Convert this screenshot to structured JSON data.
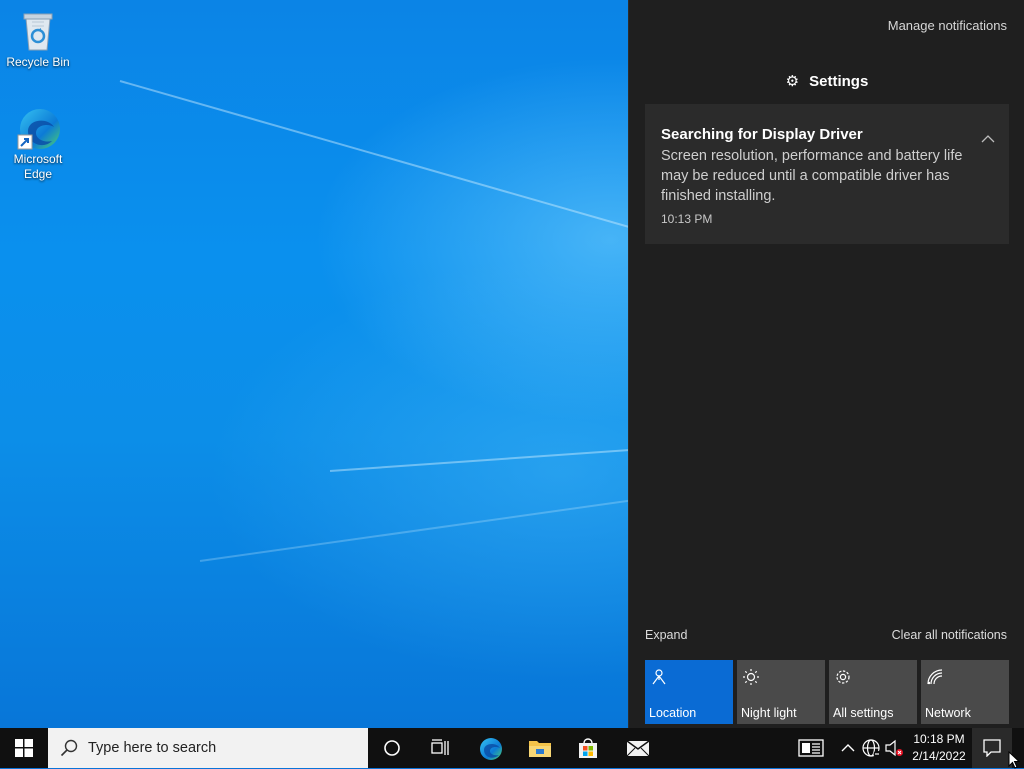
{
  "desktop": {
    "icons": [
      {
        "label": "Recycle Bin",
        "icon": "recycle-bin-icon"
      },
      {
        "label": "Microsoft Edge",
        "icon": "edge-icon"
      }
    ]
  },
  "action_center": {
    "manage_notifications": "Manage notifications",
    "group_header": "Settings",
    "group_icon": "gear-icon",
    "notification": {
      "title": "Searching for Display Driver",
      "body": "Screen resolution, performance and battery life may be reduced until a compatible driver has finished installing.",
      "time": "10:13 PM"
    },
    "expand": "Expand",
    "clear_all": "Clear all notifications",
    "quick_actions": [
      {
        "label": "Location",
        "icon": "location-icon",
        "active": true
      },
      {
        "label": "Night light",
        "icon": "night-light-icon",
        "active": false
      },
      {
        "label": "All settings",
        "icon": "gear-icon",
        "active": false
      },
      {
        "label": "Network",
        "icon": "network-icon",
        "active": false
      }
    ]
  },
  "taskbar": {
    "search_placeholder": "Type here to search",
    "pinned": [
      "cortana-icon",
      "task-view-icon",
      "edge-icon",
      "file-explorer-icon",
      "microsoft-store-icon",
      "mail-icon"
    ],
    "tray": [
      "news-icon",
      "chevron-up-icon",
      "network-icon",
      "volume-muted-icon"
    ],
    "time": "10:18 PM",
    "date": "2/14/2022"
  },
  "colors": {
    "accent": "#0a6bd4",
    "panel": "#1f1f1f",
    "toast": "#2b2b2b",
    "tile": "#4a4a4a",
    "taskbar": "#101010"
  }
}
